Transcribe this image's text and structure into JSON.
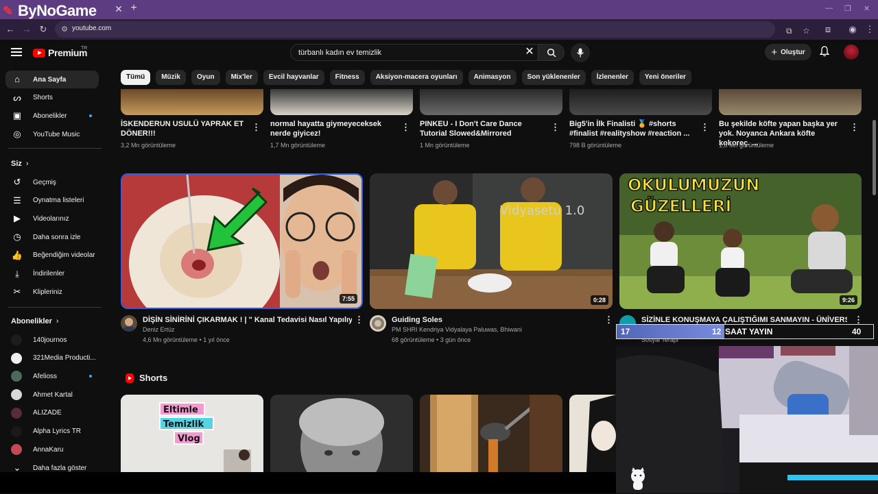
{
  "browser": {
    "brand": "ByNoGame",
    "url": "youtube.com"
  },
  "header": {
    "logo": "Premium",
    "logo_region": "TR",
    "search_value": "türbanlı kadın ev temizlik",
    "create_label": "Oluştur"
  },
  "chips": [
    "Tümü",
    "Müzik",
    "Oyun",
    "Mix'ler",
    "Evcil hayvanlar",
    "Fitness",
    "Aksiyon-macera oyunları",
    "Animasyon",
    "Son yüklenenler",
    "İzlenenler",
    "Yeni öneriler"
  ],
  "sidebar": {
    "main": [
      {
        "label": "Ana Sayfa",
        "icon": "home-icon"
      },
      {
        "label": "Shorts",
        "icon": "shorts-icon"
      },
      {
        "label": "Abonelikler",
        "icon": "subscriptions-icon"
      },
      {
        "label": "YouTube Music",
        "icon": "youtube-music-icon"
      }
    ],
    "you_heading": "Siz",
    "you": [
      {
        "label": "Geçmiş",
        "icon": "history-icon"
      },
      {
        "label": "Oynatma listeleri",
        "icon": "playlists-icon"
      },
      {
        "label": "Videolarınız",
        "icon": "your-videos-icon"
      },
      {
        "label": "Daha sonra izle",
        "icon": "watch-later-icon"
      },
      {
        "label": "Beğendiğim videolar",
        "icon": "liked-videos-icon"
      },
      {
        "label": "İndirilenler",
        "icon": "downloads-icon"
      },
      {
        "label": "Klipleriniz",
        "icon": "clips-icon"
      }
    ],
    "subs_heading": "Abonelikler",
    "subs": [
      {
        "label": "140journos",
        "color": "#1d1d1d"
      },
      {
        "label": "321Media Producti...",
        "color": "#eeeeee"
      },
      {
        "label": "Afelioss",
        "color": "#4a6a5a"
      },
      {
        "label": "Ahmet Kartal",
        "color": "#d8d8d8"
      },
      {
        "label": "ALIZADE",
        "color": "#5a2a36"
      },
      {
        "label": "Alpha Lyrics TR",
        "color": "#1a1a1a"
      },
      {
        "label": "AnnaKaru",
        "color": "#c24a55"
      }
    ],
    "more_label": "Daha fazla göster"
  },
  "top_row": [
    {
      "title": "İSKENDERUN USULÜ YAPRAK ET DÖNER!!!",
      "meta": "3,2 Mn görüntüleme"
    },
    {
      "title": "normal hayatta giymeyeceksek nerde giyicez!",
      "meta": "1,7 Mn görüntüleme"
    },
    {
      "title": "PINKEU - I Don't Care Dance Tutorial Slowed&Mirrored",
      "meta": "1 Mn görüntüleme"
    },
    {
      "title": "Big5'in İlk Finalisti 🏅 #shorts #finalist #realityshow #reaction ...",
      "meta": "798 B görüntüleme"
    },
    {
      "title": "Bu şekilde köfte yapan başka yer yok. Noyanca Ankara köfte kokoreç. ...",
      "meta": "1,6 Mn görüntüleme"
    }
  ],
  "videos": [
    {
      "title": "DİŞİN SİNİRİNİ ÇIKARMAK ! | \" Kanal Tedavisi Nasıl Yapılıyor ? \"",
      "channel": "Deniz Ertüz",
      "meta": "4,6 Mn görüntüleme • 1 yıl önce",
      "duration": "7:55"
    },
    {
      "title": "Guiding Soles",
      "channel": "PM SHRI Kendriya Vidyalaya Paluwas, Bhiwani",
      "meta": "68 görüntüleme • 3 gün önce",
      "duration": "0:28",
      "thumb_text": "Vidyasetu 1.0"
    },
    {
      "title": "SİZİNLE KONUŞMAYA ÇALIŞTIĞIMI SANMAYIN - ÜNİVERSİTE",
      "channel": "Sosyal Terapi",
      "duration": "9:26",
      "thumb_line1": "OKULUMUZUN",
      "thumb_line2": "GÜZELLERİ"
    }
  ],
  "shorts": {
    "heading": "Shorts",
    "first_caption": [
      "Eltimle",
      "Temizlik",
      "Vlog"
    ]
  },
  "overlay": {
    "left_num": "17",
    "mid_num": "12",
    "label": "SAAT YAYIN",
    "right_num": "40",
    "fill_fraction": 0.42
  }
}
